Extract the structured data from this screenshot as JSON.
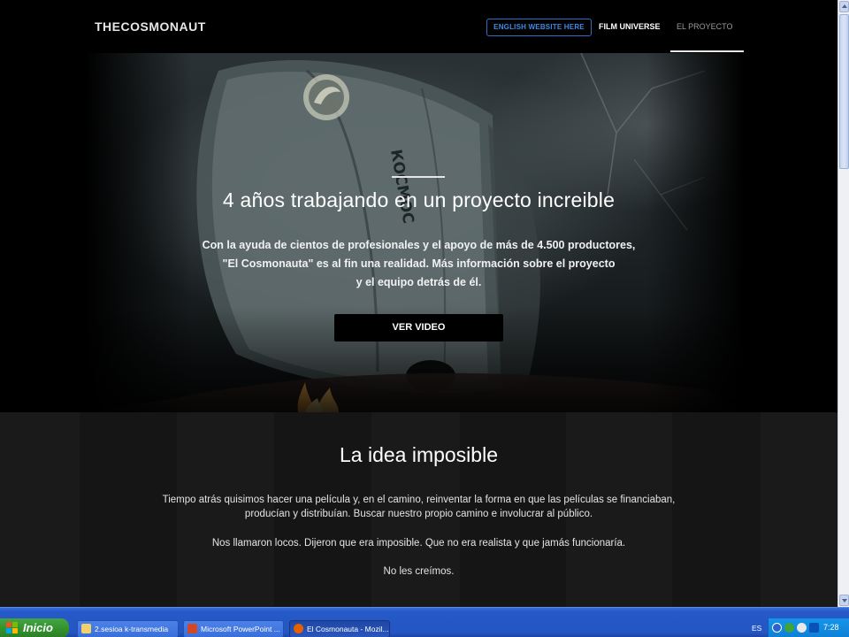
{
  "nav": {
    "logo": "THECOSMONAUT",
    "english_button": "ENGLISH WEBSITE HERE",
    "film_universe": "FILM UNIVERSE",
    "el_proyecto": "EL PROYECTO"
  },
  "hero": {
    "title": "4 años trabajando en un proyecto increible",
    "lines": [
      "Con la ayuda de cientos de profesionales y el apoyo de más de 4.500 productores,",
      "\"El Cosmonauta\" es al fin una realidad. Más información sobre el proyecto",
      "y el equipo detrás de él."
    ],
    "capsule_text": "КОСМОС",
    "button": "VER VIDEO"
  },
  "idea": {
    "title": "La idea imposible",
    "p1a": "Tiempo atrás quisimos hacer una película y, en el camino, reinventar la forma en que las películas se financiaban,",
    "p1b": "producían y distribuían. Buscar nuestro propio camino e involucrar al público.",
    "p2": "Nos llamaron locos. Dijeron que era imposible. Que no era realista y que jamás funcionaría.",
    "p3": "No les creímos."
  },
  "taskbar": {
    "start": "Inicio",
    "items": [
      {
        "label": "2.sesioa k-transmedia",
        "icon": "folder-icon"
      },
      {
        "label": "Microsoft PowerPoint ...",
        "icon": "powerpoint-icon"
      },
      {
        "label": "El Cosmonauta - Mozil...",
        "icon": "firefox-icon"
      }
    ],
    "lang": "ES",
    "clock": "7:28"
  },
  "colors": {
    "accent_blue": "#3d8ae8",
    "taskbar_blue": "#2455c3",
    "start_green": "#35932f"
  }
}
